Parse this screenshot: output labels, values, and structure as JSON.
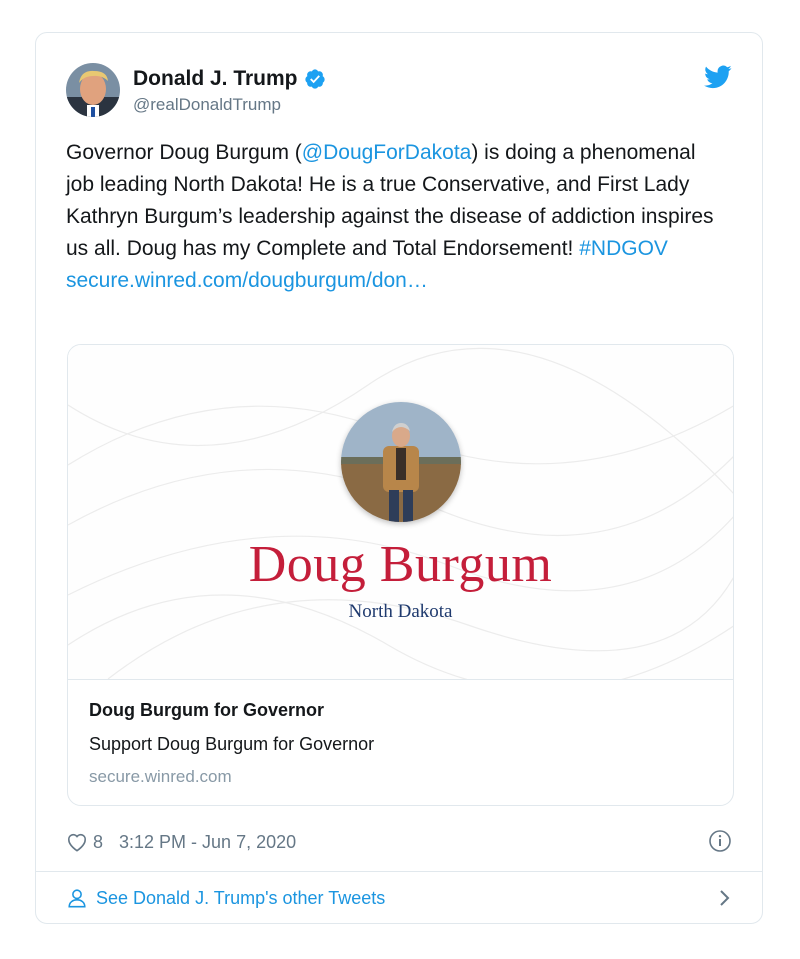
{
  "author": {
    "display_name": "Donald J. Trump",
    "handle": "@realDonaldTrump",
    "avatar_icon": "portrait-avatar",
    "verified_icon": "verified-badge-icon"
  },
  "tweet": {
    "text_prefix": "Governor Doug Burgum (",
    "mention": "@DougForDakota",
    "text_mid": ") is doing a phenomenal job leading North Dakota! He is a true Conservative, and First Lady Kathryn Burgum’s leadership against the disease of addiction inspires us all. Doug has my Complete and Total Endorsement! ",
    "hashtag": "#NDGOV",
    "url": "secure.winred.com/dougburgum/don…"
  },
  "card": {
    "image_name": "Doug Burgum",
    "image_subtitle": "North Dakota",
    "title": "Doug Burgum for Governor",
    "description": "Support Doug Burgum for Governor",
    "domain": "secure.winred.com"
  },
  "meta": {
    "likes": "8",
    "timestamp": "3:12 PM - Jun 7, 2020"
  },
  "footer": {
    "label": "See Donald J. Trump's other Tweets"
  },
  "colors": {
    "link": "#1b95e0",
    "text": "#14171a",
    "muted": "#657786",
    "border": "#e1e8ed",
    "campaign_red": "#c41e3a",
    "campaign_blue": "#1f3a6e"
  }
}
